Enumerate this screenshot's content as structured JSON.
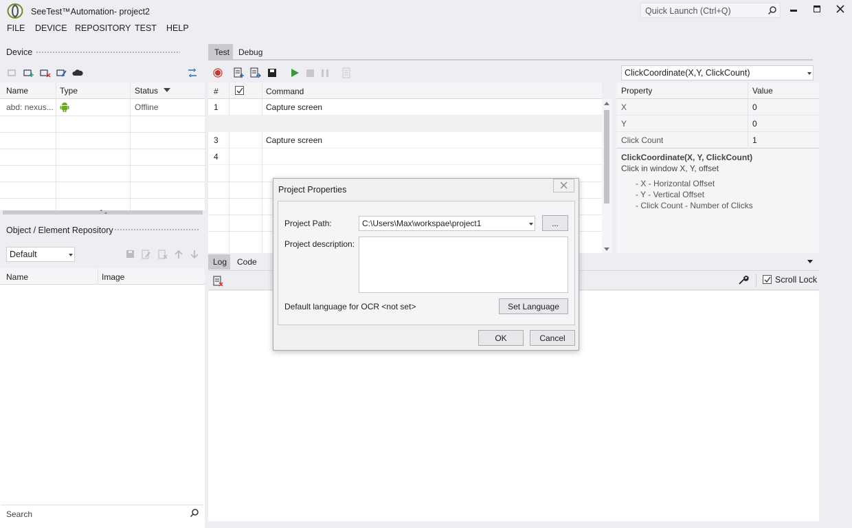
{
  "app": {
    "title": "SeeTest™Automation- project2",
    "quick_launch_placeholder": "Quick Launch (Ctrl+Q)",
    "menu": [
      "FILE",
      "DEVICE",
      "REPOSITORY",
      "TEST",
      "HELP"
    ]
  },
  "device_panel": {
    "title": "Device",
    "columns": [
      "Name",
      "Type",
      "Status"
    ],
    "rows": [
      {
        "name": "abd: nexus...",
        "type_icon": "android-icon",
        "status": "Offline"
      }
    ]
  },
  "repo_panel": {
    "title": "Object / Element Repository",
    "dropdown_value": "Default",
    "columns": [
      "Name",
      "Image"
    ],
    "search_placeholder": "Search"
  },
  "test_panel": {
    "tabs": [
      "Test",
      "Debug"
    ],
    "active_tab": "Test",
    "columns": [
      "#",
      "",
      "Command"
    ],
    "rows": [
      {
        "num": "1",
        "command": "Capture screen"
      },
      {
        "num": "",
        "command": ""
      },
      {
        "num": "3",
        "command": "Capture screen"
      },
      {
        "num": "4",
        "command": ""
      }
    ]
  },
  "properties_panel": {
    "command_dropdown": "ClickCoordinate(X,Y, ClickCount)",
    "columns": [
      "Property",
      "Value"
    ],
    "rows": [
      {
        "property": "X",
        "value": "0"
      },
      {
        "property": "Y",
        "value": "0"
      },
      {
        "property": "Click Count",
        "value": "1"
      }
    ],
    "help_title": "ClickCoordinate(X, Y, ClickCount)",
    "help_subtitle": "Click in window X, Y, offset",
    "help_items": [
      "- X - Horizontal Offset",
      "- Y - Vertical Offset",
      "- Click Count - Number of Clicks"
    ]
  },
  "log_panel": {
    "tabs": [
      "Log",
      "Code"
    ],
    "active_tab": "Log",
    "scroll_lock_label": "Scroll Lock",
    "scroll_lock_checked": true
  },
  "dialog": {
    "title": "Project Properties",
    "project_path_label": "Project Path:",
    "project_path_value": "C:\\Users\\Max\\workspae\\project1",
    "browse_label": "...",
    "description_label": "Project description:",
    "description_value": "",
    "ocr_label": "Default language for OCR <not set>",
    "set_language_label": "Set Language",
    "ok_label": "OK",
    "cancel_label": "Cancel"
  },
  "colors": {
    "accent": "#3399ff",
    "record": "#c0392b",
    "play": "#3a9a3a",
    "android": "#6ea829"
  }
}
